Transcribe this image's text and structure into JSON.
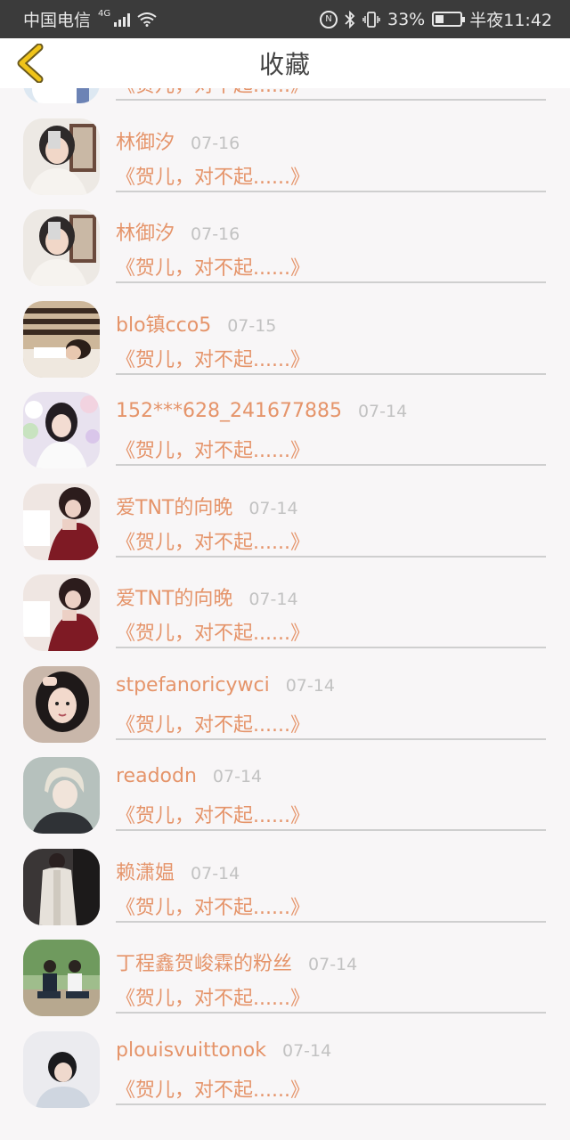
{
  "status_bar": {
    "carrier": "中国电信",
    "network": "4G",
    "battery": "33%",
    "battery_level": 0.33,
    "time": "半夜11:42"
  },
  "header": {
    "title": "收藏"
  },
  "colors": {
    "accent": "#e5946a",
    "back_icon": "#f0c419",
    "date": "#c2c2c2"
  },
  "favorites": [
    {
      "name": "",
      "date": "",
      "snippet": "《贺儿，对不起......》",
      "avatar": "girl-light"
    },
    {
      "name": "林御汐",
      "date": "07-16",
      "snippet": "《贺儿，对不起......》",
      "avatar": "girl-mirror"
    },
    {
      "name": "林御汐",
      "date": "07-16",
      "snippet": "《贺儿，对不起......》",
      "avatar": "girl-mirror"
    },
    {
      "name": "blo镇cco5",
      "date": "07-15",
      "snippet": "《贺儿，对不起......》",
      "avatar": "boy-lying"
    },
    {
      "name": "152***628_241677885",
      "date": "07-14",
      "snippet": "《贺儿，对不起......》",
      "avatar": "girl-flowers"
    },
    {
      "name": "爱TNT的向晚",
      "date": "07-14",
      "snippet": "《贺儿，对不起......》",
      "avatar": "girl-red"
    },
    {
      "name": "爱TNT的向晚",
      "date": "07-14",
      "snippet": "《贺儿，对不起......》",
      "avatar": "girl-red"
    },
    {
      "name": "stpefanoricywci",
      "date": "07-14",
      "snippet": "《贺儿，对不起......》",
      "avatar": "girl-portrait"
    },
    {
      "name": "readodn",
      "date": "07-14",
      "snippet": "《贺儿，对不起......》",
      "avatar": "anime-boy"
    },
    {
      "name": "赖潇媪",
      "date": "07-14",
      "snippet": "《贺儿，对不起......》",
      "avatar": "coat-mirror"
    },
    {
      "name": "丁程鑫贺峻霖的粉丝",
      "date": "07-14",
      "snippet": "《贺儿，对不起......》",
      "avatar": "two-boys"
    },
    {
      "name": "plouisvuittonok",
      "date": "07-14",
      "snippet": "《贺儿，对不起......》",
      "avatar": "boy-light"
    }
  ]
}
